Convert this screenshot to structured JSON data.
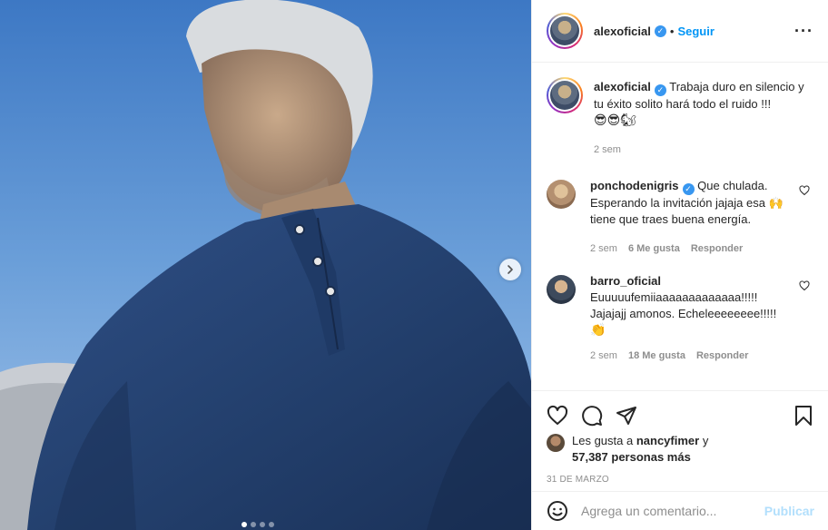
{
  "post": {
    "carousel": {
      "total_slides": 4,
      "active_index": 0
    },
    "author": {
      "username": "alexoficial",
      "verified": true,
      "follow_label": "Seguir",
      "separator": "•"
    },
    "more_icon": "more-horizontal-icon",
    "caption": {
      "username": "alexoficial",
      "text": "Trabaja duro en silencio y tu éxito solito hará todo el ruido !!!",
      "emojis": "😎😎🐿",
      "time": "2 sem"
    },
    "comments": [
      {
        "username": "ponchodenigris",
        "verified": true,
        "text": "Que chulada. Esperando la invitación jajaja esa 🙌 tiene que traes buena energía.",
        "time": "2 sem",
        "likes": "6 Me gusta",
        "reply": "Responder"
      },
      {
        "username": "barro_oficial",
        "verified": false,
        "text": "Euuuuufemiiaaaaaaaaaaaaa!!!!! Jajajajj amonos. Echeleeeeeeee!!!!!",
        "emojis": "👏",
        "time": "2 sem",
        "likes": "18 Me gusta",
        "reply": "Responder"
      }
    ],
    "likes": {
      "prefix": "Les gusta a",
      "user": "nancyfimer",
      "connector": "y",
      "count": "57,387 personas más"
    },
    "date": "31 DE MARZO",
    "add_comment": {
      "placeholder": "Agrega un comentario...",
      "publish": "Publicar"
    }
  },
  "colors": {
    "link": "#0095f6",
    "verified": "#3897f0",
    "muted": "#8e8e8e",
    "publish_disabled": "#b2dffc"
  }
}
